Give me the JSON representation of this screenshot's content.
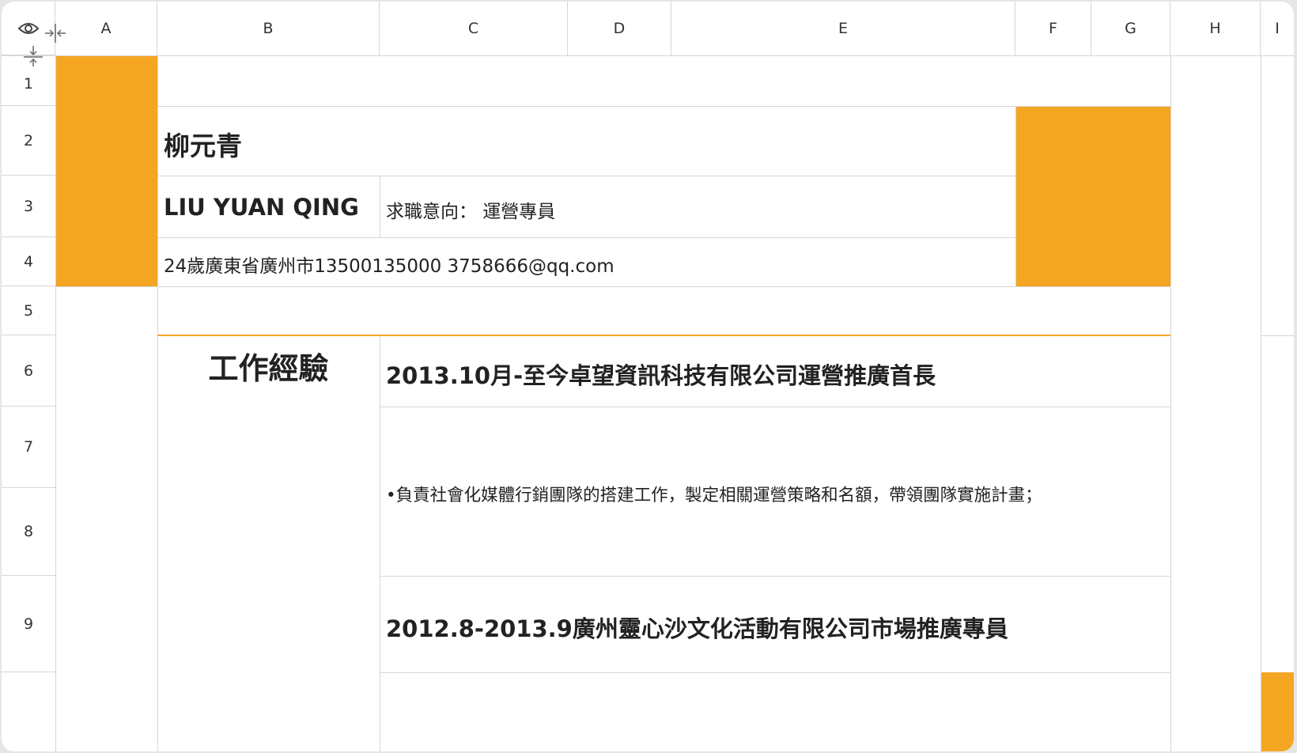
{
  "colors": {
    "accent": "#f4a623",
    "grid": "#d6d6d6",
    "text": "#222222"
  },
  "controls": {
    "visibility_icon": "eye-icon",
    "collapse_columns_icon": "collapse-columns-icon",
    "collapse_rows_icon": "collapse-rows-icon"
  },
  "columns": [
    "A",
    "B",
    "C",
    "D",
    "E",
    "F",
    "G",
    "H",
    "I"
  ],
  "rows": [
    "1",
    "2",
    "3",
    "4",
    "5",
    "6",
    "7",
    "8",
    "9"
  ],
  "resume": {
    "name": "柳元青",
    "name_en": "LIU YUAN QING",
    "job_intent": "求職意向：  運營專員",
    "contact": "24歲廣東省廣州市13500135000 3758666@qq.com",
    "section_title": "工作經驗",
    "job1_title": "2013.10月-至今卓望資訊科技有限公司運營推廣首長",
    "job1_desc": "•負責社會化媒體行銷團隊的搭建工作，製定相關運營策略和名額，帶領團隊實施計畫；",
    "job2_title": "2012.8-2013.9廣州靈心沙文化活動有限公司市場推廣專員"
  }
}
